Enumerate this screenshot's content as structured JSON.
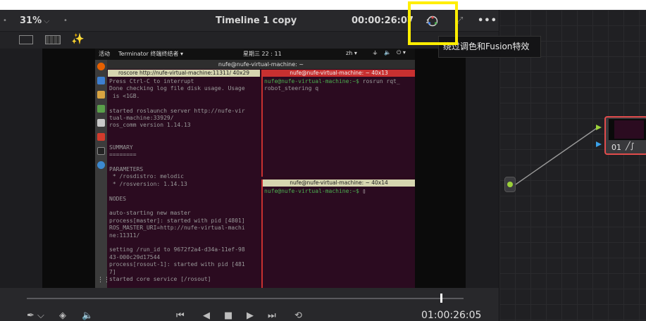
{
  "toolbar": {
    "zoom": "31%",
    "timeline_title": "Timeline 1 copy",
    "timecode": "00:00:26:07",
    "more": "•••"
  },
  "tooltip": "绕过调色和Fusion特效",
  "ubuntu": {
    "activities": "活动",
    "app": "Terminator 终端终结者 ▾",
    "clock": "星期三 22 : 11",
    "lang": "zh ▾",
    "window_title": "nufe@nufe-virtual-machine: ~"
  },
  "panes": {
    "left_title": "roscore http://nufe-virtual-machine:11311/ 40x29",
    "left_lines": "Press Ctrl-C to interrupt\nDone checking log file disk usage. Usage\n is <1GB.\n\nstarted roslaunch server http://nufe-vir\ntual-machine:33929/\nros_comm version 1.14.13\n\n\nSUMMARY\n========\n\nPARAMETERS\n * /rosdistro: melodic\n * /rosversion: 1.14.13\n\nNODES\n\nauto-starting new master\nprocess[master]: started with pid [4801]\nROS_MASTER_URI=http://nufe-virtual-machi\nne:11311/\n\nsetting /run_id to 9672f2a4-d34a-11ef-98\n43-000c29d17544\nprocess[rosout-1]: started with pid [481\n7]\nstarted core service [/rosout]",
    "right_top_title": "nufe@nufe-virtual-machine: ~ 40x13",
    "right_top_prompt": "nufe@nufe-virtual-machine:~$",
    "right_top_cmd": " rosrun rqt_\nrobot_steering q",
    "right_bottom_title": "nufe@nufe-virtual-machine: ~ 40x14",
    "right_bottom_prompt": "nufe@nufe-virtual-machine:~$"
  },
  "node": {
    "label": "01"
  },
  "transport": {
    "timecode": "01:00:26:05"
  },
  "colors": {
    "highlight": "#ffee00",
    "node_border": "#e24c4c",
    "terminal_bg": "#2b0b20"
  }
}
